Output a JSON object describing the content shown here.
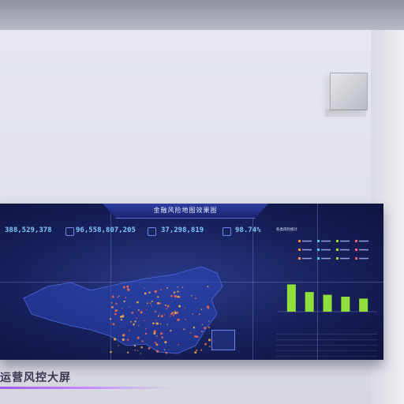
{
  "screen": {
    "title": "金融风险地图效果图",
    "kpis": [
      {
        "label": "",
        "value": "388,529,378"
      },
      {
        "label": "",
        "value": "96,558,807,205"
      },
      {
        "label": "",
        "value": "37,298,819"
      },
      {
        "label": "",
        "value": "98.74%"
      }
    ],
    "map_caption": "",
    "right_panel": {
      "title1": "各类风险统计",
      "title2": "",
      "title3": ""
    }
  },
  "caption": "运营风控大屏",
  "colors": {
    "accent": "#7fc8ff",
    "bar_green": "#8fe03a",
    "map_dot": "#ff6a4a"
  },
  "chart_data": {
    "type": "bar",
    "categories": [
      "",
      "",
      "",
      "",
      ""
    ],
    "values": [
      100,
      72,
      62,
      55,
      48
    ],
    "title": "",
    "xlabel": "",
    "ylabel": "",
    "ylim": [
      0,
      110
    ]
  }
}
